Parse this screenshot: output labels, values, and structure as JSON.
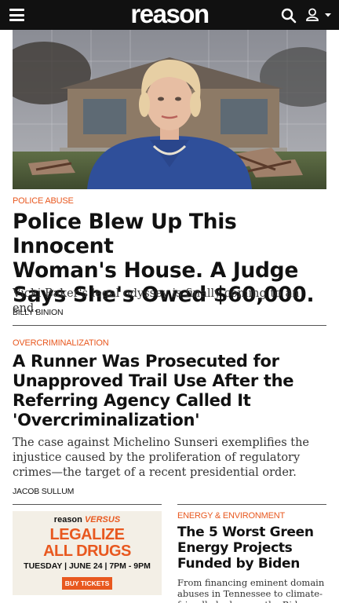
{
  "header": {
    "logo_text": "reason",
    "menu_icon": "hamburger-menu-icon",
    "search_icon": "search-icon",
    "account_icon": "user-icon",
    "dropdown_icon": "caret-down-icon"
  },
  "colors": {
    "accent": "#e8581f",
    "header_bg": "#111111",
    "text": "#111111"
  },
  "articles": [
    {
      "kicker": "POLICE ABUSE",
      "headline": "Police Blew Up This Innocent Woman's House. A Judge Says She's Owed $60,000.",
      "headline_lines": [
        "Police Blew Up This Innocent",
        "Woman's House. A Judge",
        "Says She's Owed $60,000."
      ],
      "dek": "Vicki Baker's legal odyssey is finally coming to an end.",
      "byline": "BILLY BINION"
    },
    {
      "kicker": "OVERCRIMINALIZATION",
      "headline": "A Runner Was Prosecuted for Unapproved Trail Use After the Referring Agency Called It 'Overcriminalization'",
      "headline_lines": [
        "A Runner Was Prosecuted for",
        "Unapproved Trail Use After the",
        "Referring Agency Called It",
        "'Overcriminalization'"
      ],
      "dek": "The case against Michelino Sunseri exemplifies the injustice caused by the proliferation of regulatory crimes—the target of a recent presidential order.",
      "byline": "JACOB SULLUM"
    },
    {
      "kicker": "ENERGY & ENVIRONMENT",
      "headline": "The 5 Worst Green Energy Projects Funded by Biden",
      "headline_lines": [
        "The 5 Worst Green",
        "Energy Projects",
        "Funded by Biden"
      ],
      "dek": "From financing eminent domain abuses in Tennessee to climate-friendly hydrogen, the Biden"
    }
  ],
  "ad": {
    "brand": "reason",
    "versus": "VERSUS",
    "line1": "LEGALIZE",
    "line2": "ALL DRUGS",
    "date": "TUESDAY | JUNE 24 | 7PM - 9PM",
    "cta": "BUY TICKETS"
  }
}
